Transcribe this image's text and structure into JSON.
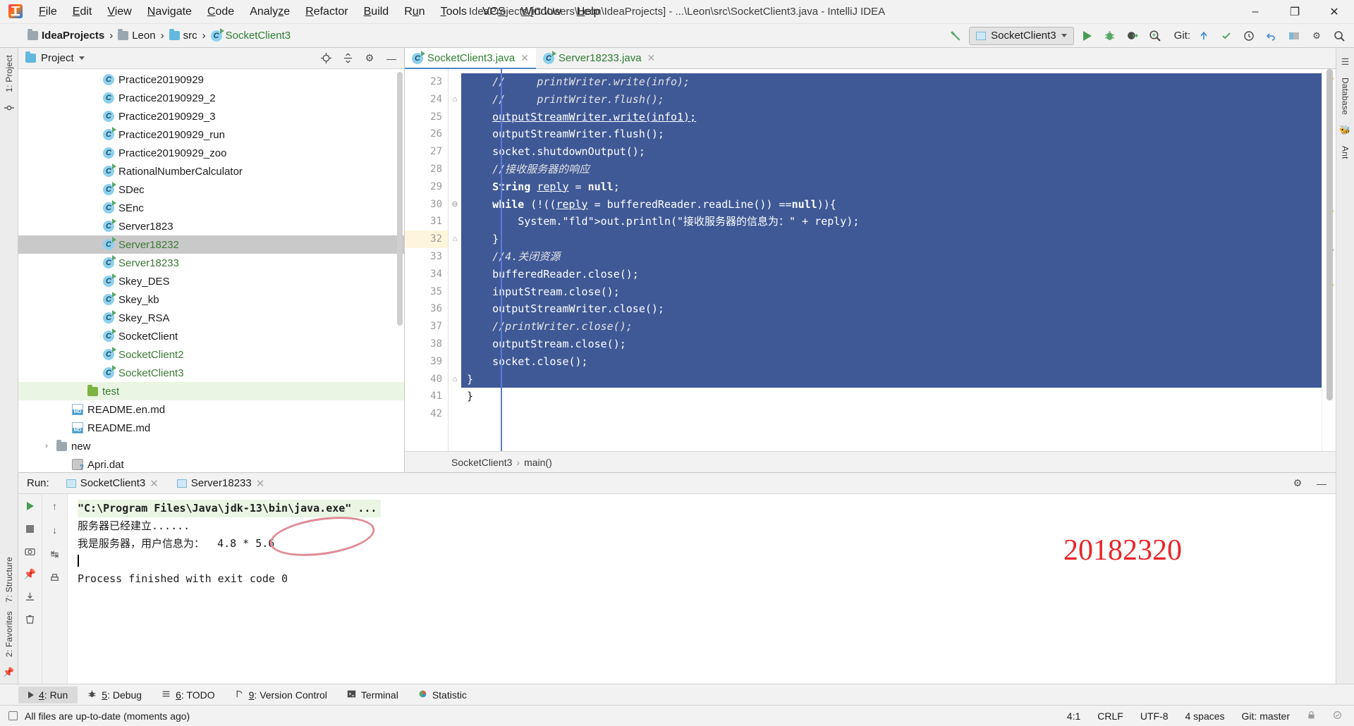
{
  "window": {
    "title": "IdeaProjects [C:\\Users\\Leon\\IdeaProjects] - ...\\Leon\\src\\SocketClient3.java - IntelliJ IDEA",
    "minimize": "–",
    "maximize": "❐",
    "close": "✕"
  },
  "menu": [
    {
      "label": "File"
    },
    {
      "label": "Edit"
    },
    {
      "label": "View"
    },
    {
      "label": "Navigate"
    },
    {
      "label": "Code"
    },
    {
      "label": "Analyze"
    },
    {
      "label": "Refactor"
    },
    {
      "label": "Build"
    },
    {
      "label": "Run"
    },
    {
      "label": "Tools"
    },
    {
      "label": "VCS"
    },
    {
      "label": "Window"
    },
    {
      "label": "Help"
    }
  ],
  "navbar": {
    "crumbs": [
      "IdeaProjects",
      "Leon",
      "src",
      "SocketClient3"
    ],
    "run_config": "SocketClient3",
    "git_label": "Git:"
  },
  "project_panel": {
    "title": "Project",
    "items": [
      {
        "label": "Practice20190929",
        "icon": "class-icon",
        "runnable": false,
        "state": "normal",
        "indent": 4
      },
      {
        "label": "Practice20190929_2",
        "icon": "class-icon",
        "runnable": false,
        "state": "normal",
        "indent": 4
      },
      {
        "label": "Practice20190929_3",
        "icon": "class-icon",
        "runnable": false,
        "state": "normal",
        "indent": 4
      },
      {
        "label": "Practice20190929_run",
        "icon": "class-icon",
        "runnable": true,
        "state": "normal",
        "indent": 4
      },
      {
        "label": "Practice20190929_zoo",
        "icon": "class-icon",
        "runnable": false,
        "state": "normal",
        "indent": 4
      },
      {
        "label": "RationalNumberCalculator",
        "icon": "class-icon",
        "runnable": true,
        "state": "normal",
        "indent": 4
      },
      {
        "label": "SDec",
        "icon": "class-icon",
        "runnable": true,
        "state": "normal",
        "indent": 4
      },
      {
        "label": "SEnc",
        "icon": "class-icon",
        "runnable": true,
        "state": "normal",
        "indent": 4
      },
      {
        "label": "Server1823",
        "icon": "class-icon",
        "runnable": true,
        "state": "normal",
        "indent": 4
      },
      {
        "label": "Server18232",
        "icon": "class-icon",
        "runnable": true,
        "state": "selected",
        "indent": 4
      },
      {
        "label": "Server18233",
        "icon": "class-icon",
        "runnable": true,
        "state": "modified",
        "indent": 4
      },
      {
        "label": "Skey_DES",
        "icon": "class-icon",
        "runnable": true,
        "state": "normal",
        "indent": 4
      },
      {
        "label": "Skey_kb",
        "icon": "class-icon",
        "runnable": true,
        "state": "normal",
        "indent": 4
      },
      {
        "label": "Skey_RSA",
        "icon": "class-icon",
        "runnable": true,
        "state": "normal",
        "indent": 4
      },
      {
        "label": "SocketClient",
        "icon": "class-icon",
        "runnable": true,
        "state": "normal",
        "indent": 4
      },
      {
        "label": "SocketClient2",
        "icon": "class-icon",
        "runnable": true,
        "state": "modified",
        "indent": 4
      },
      {
        "label": "SocketClient3",
        "icon": "class-icon",
        "runnable": true,
        "state": "modified",
        "indent": 4
      },
      {
        "label": "test",
        "icon": "folder-green-icon",
        "runnable": false,
        "state": "added",
        "indent": 3
      },
      {
        "label": "README.en.md",
        "icon": "markdown-icon",
        "runnable": false,
        "state": "normal",
        "indent": 2
      },
      {
        "label": "README.md",
        "icon": "markdown-icon",
        "runnable": false,
        "state": "normal",
        "indent": 2
      },
      {
        "label": "new",
        "icon": "folder-icon",
        "runnable": false,
        "state": "normal",
        "indent": 1,
        "twisty": "›"
      },
      {
        "label": "Apri.dat",
        "icon": "dat-file-icon",
        "runnable": false,
        "state": "normal",
        "indent": 2
      }
    ]
  },
  "editor": {
    "tabs": [
      {
        "label": "SocketClient3.java",
        "active": true
      },
      {
        "label": "Server18233.java",
        "active": false
      }
    ],
    "first_line_no": 23,
    "current_line": 32,
    "lines": [
      {
        "no": 23,
        "text": "    //     printWriter.write(info);",
        "sel": true,
        "kind": "comment",
        "fold": ""
      },
      {
        "no": 24,
        "text": "    //     printWriter.flush();",
        "sel": true,
        "kind": "comment",
        "fold": "⌂"
      },
      {
        "no": 25,
        "text": "    outputStreamWriter.write(info1);",
        "sel": true,
        "kind": "code-wavy",
        "fold": ""
      },
      {
        "no": 26,
        "text": "    outputStreamWriter.flush();",
        "sel": true,
        "kind": "code",
        "fold": ""
      },
      {
        "no": 27,
        "text": "    socket.shutdownOutput();",
        "sel": true,
        "kind": "code",
        "fold": ""
      },
      {
        "no": 28,
        "text": "    //接收服务器的响应",
        "sel": true,
        "kind": "comment",
        "fold": ""
      },
      {
        "no": 29,
        "text": "    String reply = null;",
        "sel": true,
        "kind": "decl",
        "fold": ""
      },
      {
        "no": 30,
        "text": "    while (!((reply = bufferedReader.readLine()) ==null)){",
        "sel": true,
        "kind": "while",
        "fold": "⊖"
      },
      {
        "no": 31,
        "text": "        System.out.println(\"接收服务器的信息为：\" + reply);",
        "sel": true,
        "kind": "println",
        "fold": ""
      },
      {
        "no": 32,
        "text": "    }",
        "sel": true,
        "kind": "code",
        "fold": "⌂"
      },
      {
        "no": 33,
        "text": "    //4.关闭资源",
        "sel": true,
        "kind": "comment",
        "fold": ""
      },
      {
        "no": 34,
        "text": "    bufferedReader.close();",
        "sel": true,
        "kind": "code",
        "fold": ""
      },
      {
        "no": 35,
        "text": "    inputStream.close();",
        "sel": true,
        "kind": "code",
        "fold": ""
      },
      {
        "no": 36,
        "text": "    outputStreamWriter.close();",
        "sel": true,
        "kind": "code",
        "fold": ""
      },
      {
        "no": 37,
        "text": "    //printWriter.close();",
        "sel": true,
        "kind": "comment",
        "fold": ""
      },
      {
        "no": 38,
        "text": "    outputStream.close();",
        "sel": true,
        "kind": "code",
        "fold": ""
      },
      {
        "no": 39,
        "text": "    socket.close();",
        "sel": true,
        "kind": "code",
        "fold": ""
      },
      {
        "no": 40,
        "text": "}",
        "sel": true,
        "kind": "code",
        "fold": "⌂"
      },
      {
        "no": 41,
        "text": "}",
        "sel": false,
        "kind": "code",
        "fold": ""
      },
      {
        "no": 42,
        "text": "",
        "sel": false,
        "kind": "code",
        "fold": ""
      }
    ],
    "breadcrumb": [
      "SocketClient3",
      "main()"
    ]
  },
  "run_panel": {
    "label": "Run:",
    "tabs": [
      {
        "label": "SocketClient3",
        "active": false
      },
      {
        "label": "Server18233",
        "active": true
      }
    ],
    "console_lines": [
      {
        "text": "\"C:\\Program Files\\Java\\jdk-13\\bin\\java.exe\" ...",
        "style": "command"
      },
      {
        "text": "服务器已经建立......",
        "style": "normal"
      },
      {
        "text": "我是服务器，用户信息为：  4.8 * 5.6",
        "style": "normal"
      },
      {
        "text": "",
        "style": "caret"
      },
      {
        "text": "Process finished with exit code 0",
        "style": "normal"
      }
    ],
    "annotation_number": "20182320",
    "annotation_color": "#e8262a",
    "circle_color": "#e08b95"
  },
  "tool_window_bar": [
    {
      "num": "4",
      "label": ": Run",
      "icon": "play-icon",
      "active": true
    },
    {
      "num": "5",
      "label": ": Debug",
      "icon": "bug-icon",
      "active": false
    },
    {
      "num": "6",
      "label": ": TODO",
      "icon": "list-icon",
      "active": false
    },
    {
      "num": "9",
      "label": ": Version Control",
      "icon": "branch-icon",
      "active": false
    },
    {
      "num": "",
      "label": "Terminal",
      "icon": "terminal-icon",
      "active": false
    },
    {
      "num": "",
      "label": "Statistic",
      "icon": "statistic-icon",
      "active": false
    }
  ],
  "status_bar": {
    "message": "All files are up-to-date (moments ago)",
    "caret_position": "4:1",
    "line_separator": "CRLF",
    "encoding": "UTF-8",
    "indent": "4 spaces",
    "git_branch": "Git: master",
    "event_log": "Event Log"
  },
  "left_rail": [
    {
      "label": "1: Project"
    },
    {
      "label": "2: Favorites"
    },
    {
      "label": "7: Structure"
    }
  ],
  "right_rail": [
    {
      "label": "Database"
    },
    {
      "label": "Ant"
    }
  ]
}
